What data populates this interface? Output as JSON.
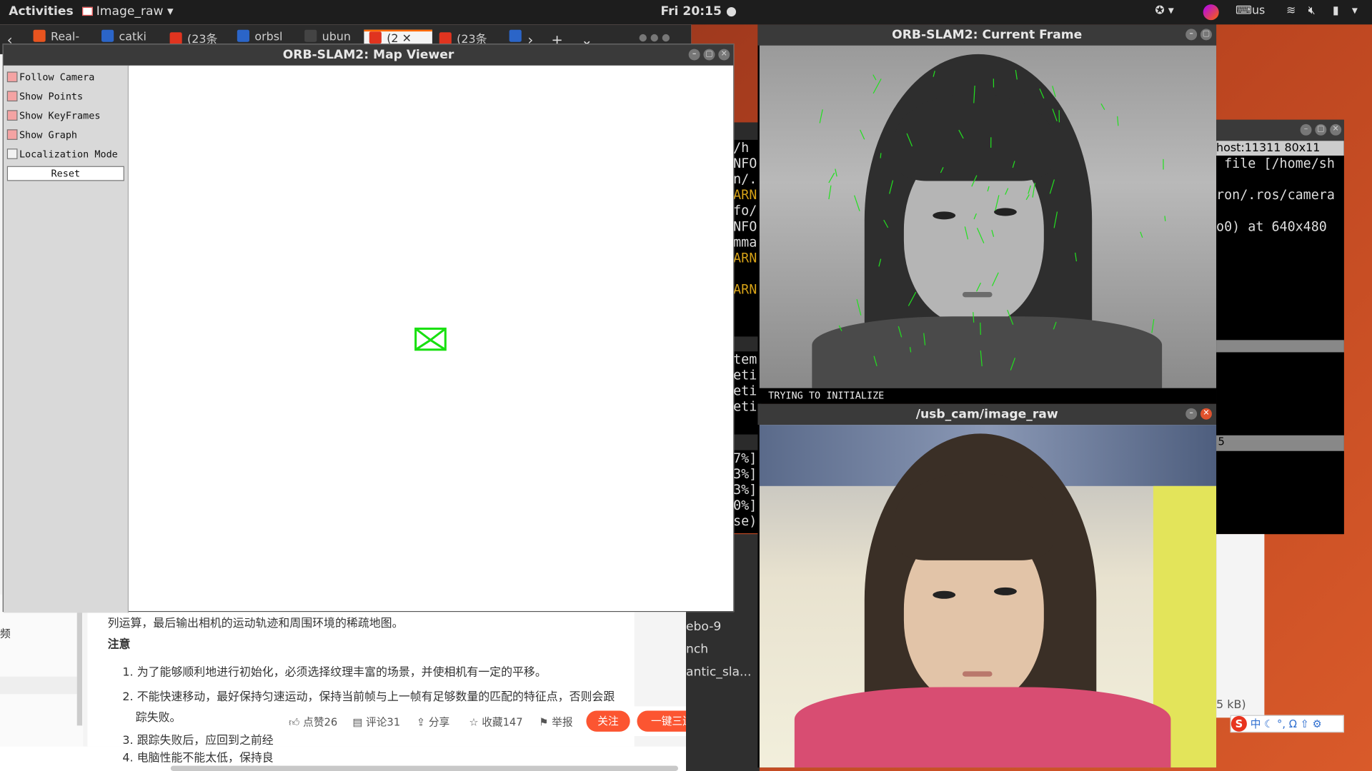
{
  "topbar": {
    "activities": "Activities",
    "app_name": "Image_raw",
    "clock": "Fri 20:15",
    "keyboard": "us"
  },
  "browser": {
    "tabs": [
      {
        "label": "Real-",
        "color": "#e8541f"
      },
      {
        "label": "catki",
        "color": "#2b65c8"
      },
      {
        "label": "(23条",
        "color": "#e0341f"
      },
      {
        "label": "orbsl",
        "color": "#2b65c8"
      },
      {
        "label": "ubun",
        "color": "#444444"
      },
      {
        "label": "(2",
        "color": "#e0341f"
      },
      {
        "label": "(23条",
        "color": "#e0341f"
      },
      {
        "label": "",
        "color": "#2b65c8"
      }
    ],
    "article": {
      "line1": "列运算，最后输出相机的运动轨迹和周围环境的稀疏地图。",
      "note_heading": "注意",
      "items": [
        "为了能够顺利地进行初始化，必须选择纹理丰富的场景，并使相机有一定的平移。",
        "不能快速移动，最好保持匀速运动，保持当前帧与上一帧有足够数量的匹配的特征点，否则会跟踪失败。",
        "跟踪失败后，应回到之前经",
        "电脑性能不能太低，保持良"
      ],
      "item_numbers": [
        "1.",
        "2.",
        "3.",
        "4."
      ]
    },
    "left_fragment": "频",
    "bottom_bar": {
      "like": "点赞26",
      "comment": "评论31",
      "share": "分享",
      "favorite": "收藏147",
      "report": "举报",
      "follow": "关注",
      "one_click": "一键三连"
    }
  },
  "map_viewer": {
    "title": "ORB-SLAM2: Map Viewer",
    "options": [
      {
        "label": "Follow Camera",
        "checked": true
      },
      {
        "label": "Show Points",
        "checked": true
      },
      {
        "label": "Show KeyFrames",
        "checked": true
      },
      {
        "label": "Show Graph",
        "checked": true
      },
      {
        "label": "Localization Mode",
        "checked": false
      }
    ],
    "reset_label": "Reset"
  },
  "current_frame": {
    "title": "ORB-SLAM2: Current Frame",
    "status": "TRYING TO INITIALIZE"
  },
  "usb_cam": {
    "title": "/usb_cam/image_raw"
  },
  "terminal_left": {
    "lines": [
      "/h",
      "NFO]",
      "n/.r",
      "ARN]",
      "fo/h",
      "NFO]",
      "mma",
      "ARN]",
      "",
      "ARN]"
    ],
    "lines2": [
      "tem",
      "etin",
      "etin",
      "etin"
    ],
    "lines3": [
      "7%]",
      "3%]",
      "3%]",
      "0%]",
      "se)"
    ]
  },
  "terminal_right": {
    "title": "host:11311 80x11",
    "lines": [
      " file [/home/sh",
      "",
      "ron/.ros/camera",
      "",
      "o0) at 640x480"
    ],
    "status_fragment": "5",
    "size_fragment": "5 kB)"
  },
  "side_list": {
    "items": [
      "ebo-9",
      "nch",
      "antic_sla..."
    ]
  },
  "ime_label": "中"
}
